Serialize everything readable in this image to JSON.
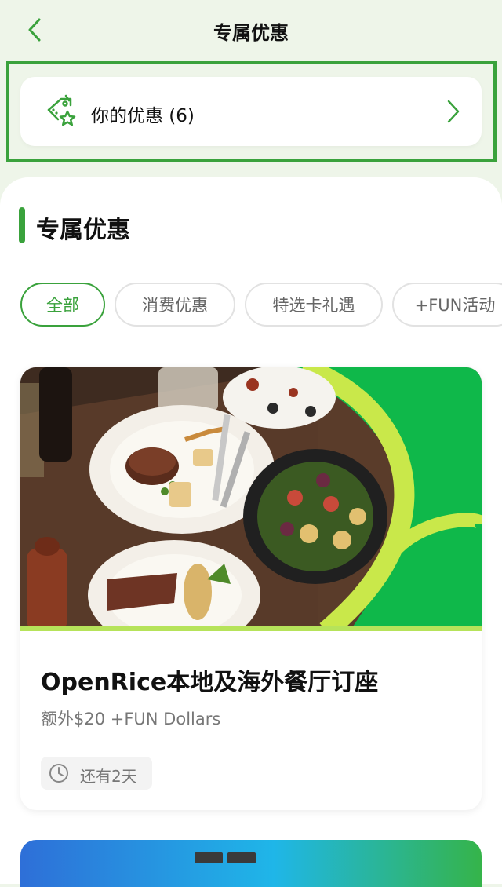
{
  "header": {
    "title": "专属优惠",
    "back_icon": "chevron-left-icon"
  },
  "my_offers": {
    "label": "你的优惠 (6)",
    "icon": "tag-star-icon",
    "chevron_icon": "chevron-right-icon"
  },
  "section": {
    "title": "专属优惠"
  },
  "tabs": [
    {
      "label": "全部",
      "active": true
    },
    {
      "label": "消费优惠",
      "active": false
    },
    {
      "label": "特选卡礼遇",
      "active": false
    },
    {
      "label": "+FUN活动",
      "active": false
    }
  ],
  "deal": {
    "title": "OpenRice本地及海外餐厅订座",
    "subtitle": "额外$20 +FUN Dollars",
    "timer": "还有2天",
    "timer_icon": "clock-icon",
    "image": "restaurant-dishes-photo"
  },
  "colors": {
    "accent": "#3aa23c",
    "background": "#eef5e9",
    "brand_green": "#0fb84a"
  }
}
